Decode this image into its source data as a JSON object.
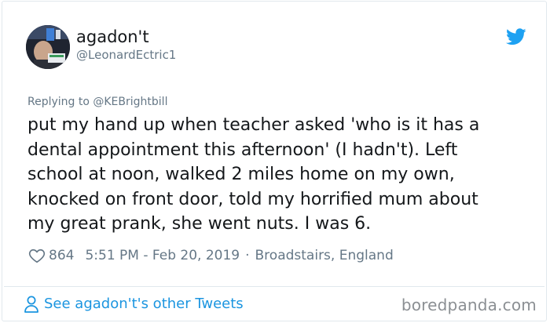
{
  "user": {
    "display_name": "agadon't",
    "handle": "@LeonardEctric1"
  },
  "tweet": {
    "replying_to": "Replying to @KEBrightbill",
    "text": "put my hand up when teacher asked 'who is it has a\ndental appointment this afternoon' (I hadn't). Left\nschool at noon, walked 2 miles home on my own,\nknocked on front door, told my horrified mum about\nmy great prank, she went nuts. I was 6.",
    "likes": "864",
    "timestamp": "5:51 PM - Feb 20, 2019",
    "separator": "·",
    "location": "Broadstairs, England"
  },
  "footer": {
    "link_label": "See agadon't's other Tweets",
    "watermark": "boredpanda.com"
  },
  "icons": {
    "twitter_bird": "twitter-bird-icon",
    "heart": "heart-icon",
    "person": "person-icon"
  },
  "colors": {
    "accent": "#1da1f2",
    "link": "#1b95e0",
    "text": "#14171a",
    "muted": "#657786",
    "border": "#e1e8ed"
  }
}
